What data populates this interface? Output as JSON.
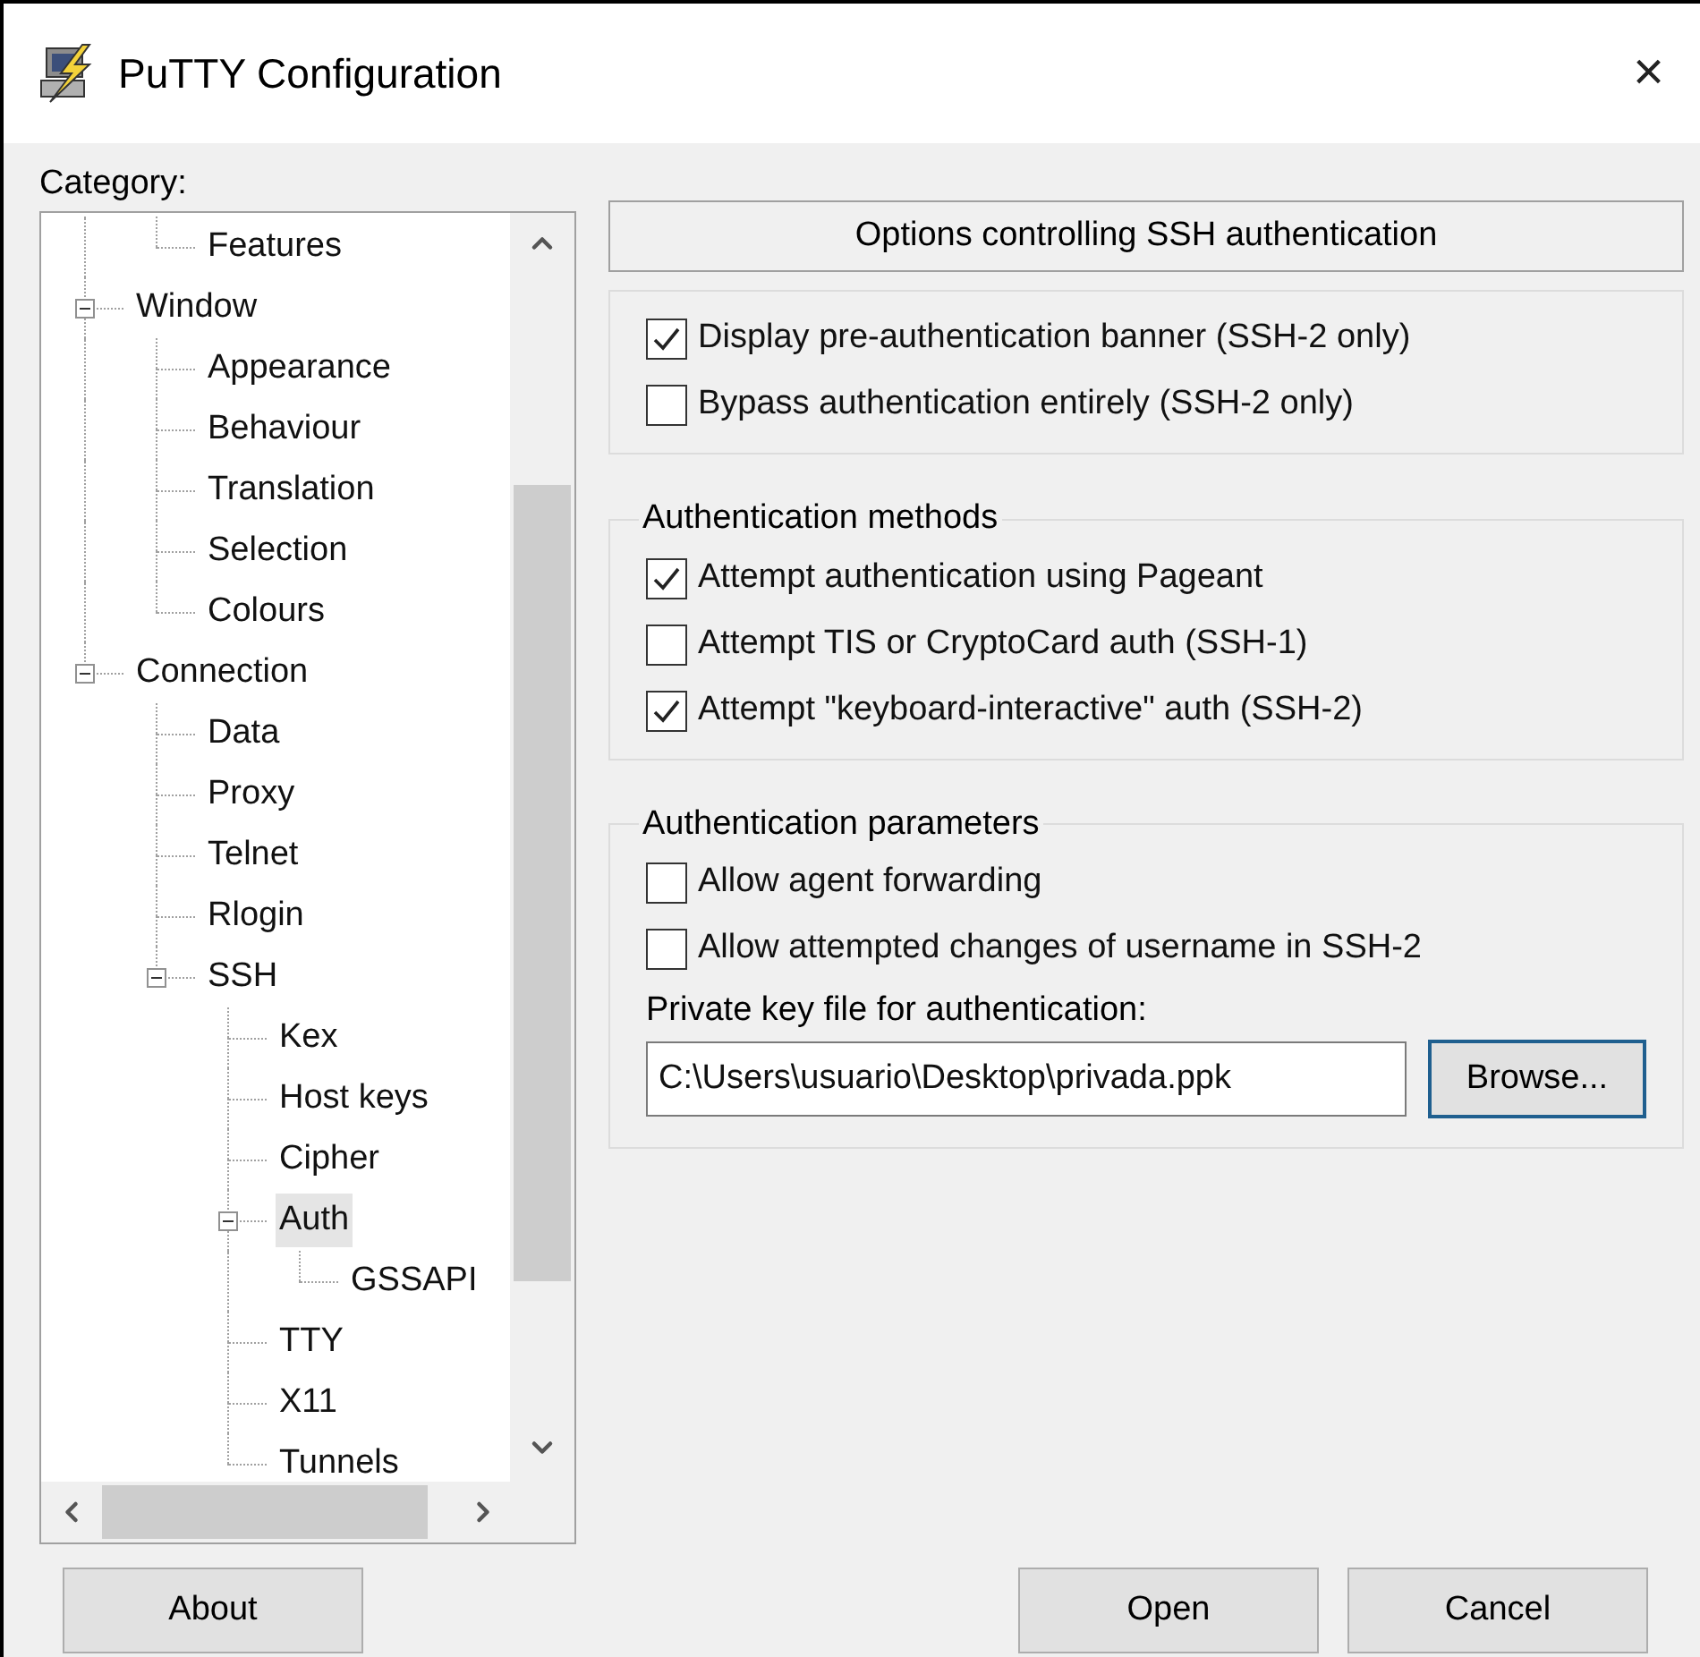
{
  "window": {
    "title": "PuTTY Configuration",
    "close": "×"
  },
  "category_label": "Category:",
  "tree": {
    "items": [
      {
        "children": [
          {
            "label": "Features",
            "selected": false
          }
        ]
      },
      {
        "label": "Window",
        "expanded": true,
        "selected": false,
        "children": [
          {
            "label": "Appearance",
            "selected": false
          },
          {
            "label": "Behaviour",
            "selected": false
          },
          {
            "label": "Translation",
            "selected": false
          },
          {
            "label": "Selection",
            "selected": false
          },
          {
            "label": "Colours",
            "selected": false
          }
        ]
      },
      {
        "label": "Connection",
        "expanded": true,
        "selected": false,
        "children": [
          {
            "label": "Data",
            "selected": false
          },
          {
            "label": "Proxy",
            "selected": false
          },
          {
            "label": "Telnet",
            "selected": false
          },
          {
            "label": "Rlogin",
            "selected": false
          },
          {
            "label": "SSH",
            "expanded": true,
            "selected": false,
            "children": [
              {
                "label": "Kex",
                "selected": false
              },
              {
                "label": "Host keys",
                "selected": false
              },
              {
                "label": "Cipher",
                "selected": false
              },
              {
                "label": "Auth",
                "expanded": true,
                "selected": true,
                "children": [
                  {
                    "label": "GSSAPI",
                    "selected": false
                  }
                ]
              },
              {
                "label": "TTY",
                "selected": false
              },
              {
                "label": "X11",
                "selected": false
              },
              {
                "label": "Tunnels",
                "selected": false
              }
            ]
          }
        ]
      }
    ]
  },
  "panel": {
    "header": "Options controlling SSH authentication",
    "groups": [
      {
        "options": [
          {
            "label": "Display pre-authentication banner (SSH-2 only)",
            "checked": true
          },
          {
            "label": "Bypass authentication entirely (SSH-2 only)",
            "checked": false
          }
        ]
      },
      {
        "title": "Authentication methods",
        "options": [
          {
            "label": "Attempt authentication using Pageant",
            "checked": true
          },
          {
            "label": "Attempt TIS or CryptoCard auth (SSH-1)",
            "checked": false
          },
          {
            "label": "Attempt \"keyboard-interactive\" auth (SSH-2)",
            "checked": true
          }
        ]
      },
      {
        "title": "Authentication parameters",
        "options": [
          {
            "label": "Allow agent forwarding",
            "checked": false
          },
          {
            "label": "Allow attempted changes of username in SSH-2",
            "checked": false
          }
        ],
        "key_file": {
          "label": "Private key file for authentication:",
          "value": "C:\\Users\\usuario\\Desktop\\privada.ppk",
          "button": "Browse...",
          "button_focused": true
        }
      }
    ]
  },
  "buttons": [
    "About",
    "Open",
    "Cancel"
  ]
}
